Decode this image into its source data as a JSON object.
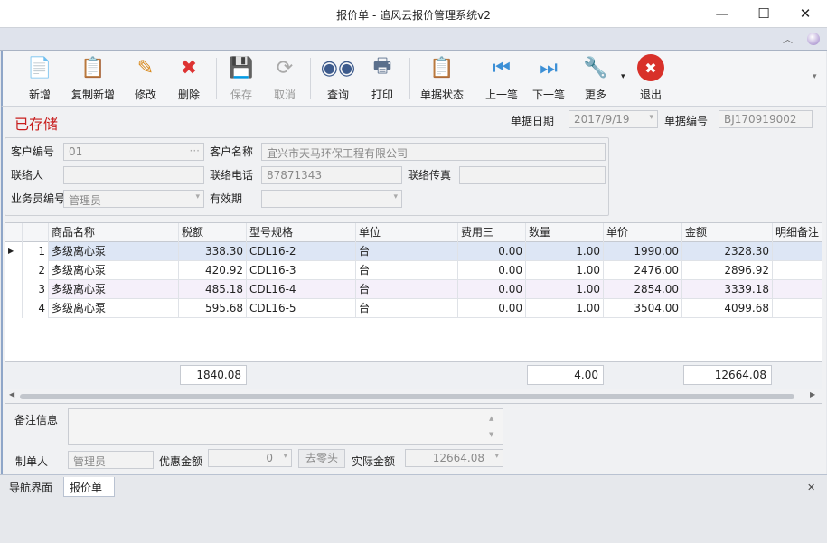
{
  "window": {
    "title": "报价单 - 追风云报价管理系统v2",
    "minimize": "—",
    "maximize": "☐",
    "close": "✕"
  },
  "toolbar": {
    "buttons": [
      {
        "label": "新增",
        "icon": "add-document-icon",
        "enabled": true
      },
      {
        "label": "复制新增",
        "icon": "copy-paste-icon",
        "enabled": true
      },
      {
        "label": "修改",
        "icon": "edit-pencil-icon",
        "enabled": true
      },
      {
        "label": "删除",
        "icon": "delete-document-icon",
        "enabled": true
      },
      {
        "label": "保存",
        "icon": "save-icon",
        "enabled": false
      },
      {
        "label": "取消",
        "icon": "undo-icon",
        "enabled": false
      },
      {
        "label": "查询",
        "icon": "binoculars-icon",
        "enabled": true
      },
      {
        "label": "打印",
        "icon": "printer-icon",
        "enabled": true
      },
      {
        "label": "单据状态",
        "icon": "clipboard-icon",
        "enabled": true
      },
      {
        "label": "上一笔",
        "icon": "previous-icon",
        "enabled": true
      },
      {
        "label": "下一笔",
        "icon": "next-icon",
        "enabled": true
      },
      {
        "label": "更多",
        "icon": "tools-icon",
        "enabled": true
      },
      {
        "label": "退出",
        "icon": "exit-icon",
        "enabled": true
      }
    ]
  },
  "status": {
    "text": "已存储",
    "color": "#c81e1e"
  },
  "header": {
    "date_label": "单据日期",
    "date_value": "2017/9/19",
    "number_label": "单据编号",
    "number_value": "BJ170919002"
  },
  "customer": {
    "code_label": "客户编号",
    "code_value": "01",
    "code_button": "···",
    "name_label": "客户名称",
    "name_value": "宜兴市天马环保工程有限公司",
    "contact_label": "联络人",
    "contact_value": "",
    "phone_label": "联络电话",
    "phone_value": "87871343",
    "fax_label": "联络传真",
    "fax_value": "",
    "salesman_label": "业务员编号",
    "salesman_value": "管理员",
    "validity_label": "有效期",
    "validity_value": ""
  },
  "grid": {
    "columns": [
      "商品名称",
      "税额",
      "型号规格",
      "单位",
      "费用三",
      "数量",
      "单价",
      "金额",
      "明细备注"
    ],
    "rows": [
      {
        "no": "1",
        "name": "多级离心泵",
        "tax": "338.30",
        "model": "CDL16-2",
        "unit": "台",
        "fee3": "0.00",
        "qty": "1.00",
        "price": "1990.00",
        "amount": "2328.30",
        "note": ""
      },
      {
        "no": "2",
        "name": "多级离心泵",
        "tax": "420.92",
        "model": "CDL16-3",
        "unit": "台",
        "fee3": "0.00",
        "qty": "1.00",
        "price": "2476.00",
        "amount": "2896.92",
        "note": ""
      },
      {
        "no": "3",
        "name": "多级离心泵",
        "tax": "485.18",
        "model": "CDL16-4",
        "unit": "台",
        "fee3": "0.00",
        "qty": "1.00",
        "price": "2854.00",
        "amount": "3339.18",
        "note": ""
      },
      {
        "no": "4",
        "name": "多级离心泵",
        "tax": "595.68",
        "model": "CDL16-5",
        "unit": "台",
        "fee3": "0.00",
        "qty": "1.00",
        "price": "3504.00",
        "amount": "4099.68",
        "note": ""
      }
    ],
    "totals": {
      "tax": "1840.08",
      "qty": "4.00",
      "amount": "12664.08"
    }
  },
  "footer": {
    "remark_label": "备注信息",
    "remark_value": "",
    "maker_label": "制单人",
    "maker_value": "管理员",
    "discount_label": "优惠金额",
    "discount_value": "0",
    "round_button": "去零头",
    "actual_label": "实际金额",
    "actual_value": "12664.08"
  },
  "tabs": [
    {
      "label": "导航界面",
      "active": false
    },
    {
      "label": "报价单",
      "active": true
    }
  ],
  "tab_close": "✕"
}
